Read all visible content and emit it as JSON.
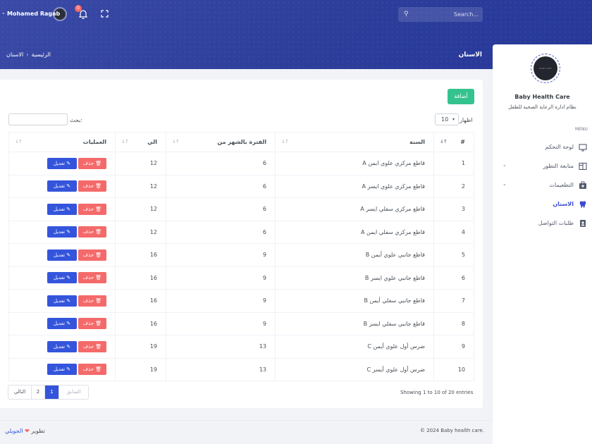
{
  "header": {
    "search_placeholder": "Search...",
    "notification_count": "0",
    "user_name": "Mohamed Ragab",
    "page_title": "الاسنان",
    "breadcrumb": [
      "الرئيسية",
      "الاسنان"
    ]
  },
  "sidebar": {
    "app_name": "Baby Health Care",
    "app_subtitle": "نظام ادارة الرعاية الصحية للطفل",
    "menu_label": "MENU",
    "items": [
      {
        "label": "لوحة التحكم",
        "icon": "monitor-icon",
        "active": false,
        "has_submenu": false
      },
      {
        "label": "متابعة التطور",
        "icon": "columns-icon",
        "active": false,
        "has_submenu": true
      },
      {
        "label": "التطعيمات",
        "icon": "medkit-icon",
        "active": false,
        "has_submenu": true
      },
      {
        "label": "الاسنان",
        "icon": "tooth-icon",
        "active": true,
        "has_submenu": false
      },
      {
        "label": "طلبات التواصل",
        "icon": "contact-card-icon",
        "active": false,
        "has_submenu": false
      }
    ]
  },
  "content": {
    "add_button": "أضافة",
    "show_label": "اظهار",
    "show_value": "10",
    "search_label": "بحث:",
    "columns": [
      "#",
      "السنة",
      "الفترة بالشهر من",
      "الي",
      "العمليات"
    ],
    "rows": [
      {
        "num": "1",
        "tooth": "قاطع مركزي علوي ايمن A",
        "from": "6",
        "to": "12"
      },
      {
        "num": "2",
        "tooth": "قاطع مركزي علوي ايسر A",
        "from": "6",
        "to": "12"
      },
      {
        "num": "3",
        "tooth": "قاطع مركزي سفلي ايسر A",
        "from": "6",
        "to": "12"
      },
      {
        "num": "4",
        "tooth": "قاطع مركزي سفلي ايمن A",
        "from": "6",
        "to": "12"
      },
      {
        "num": "5",
        "tooth": "قاطع جانبي علوي أيمن B",
        "from": "9",
        "to": "16"
      },
      {
        "num": "6",
        "tooth": "قاطع جانبي علوي ايسر B",
        "from": "9",
        "to": "16"
      },
      {
        "num": "7",
        "tooth": "قاطع جانبي سفلي أيمن B",
        "from": "9",
        "to": "16"
      },
      {
        "num": "8",
        "tooth": "قاطع جانبي سفلي ايسر B",
        "from": "9",
        "to": "16"
      },
      {
        "num": "9",
        "tooth": "ضرس أول علوي أيمن C",
        "from": "13",
        "to": "19"
      },
      {
        "num": "10",
        "tooth": "ضرس أول علوي أيسر C",
        "from": "13",
        "to": "19"
      }
    ],
    "edit_label": "تعديل",
    "delete_label": "حذف",
    "info": "Showing 1 to 10 of 20 entries",
    "pagination": {
      "prev": "السابق",
      "pages": [
        "1",
        "2"
      ],
      "current": "1",
      "next": "التالي"
    }
  },
  "footer": {
    "copyright": "© 2024 Baby health care.",
    "dev_prefix": "تطوير",
    "dev_name": "الجويلي"
  },
  "colors": {
    "primary": "#3455db",
    "success": "#34c38f",
    "danger": "#f46a6a",
    "header_bg": "#2c3d9a"
  }
}
